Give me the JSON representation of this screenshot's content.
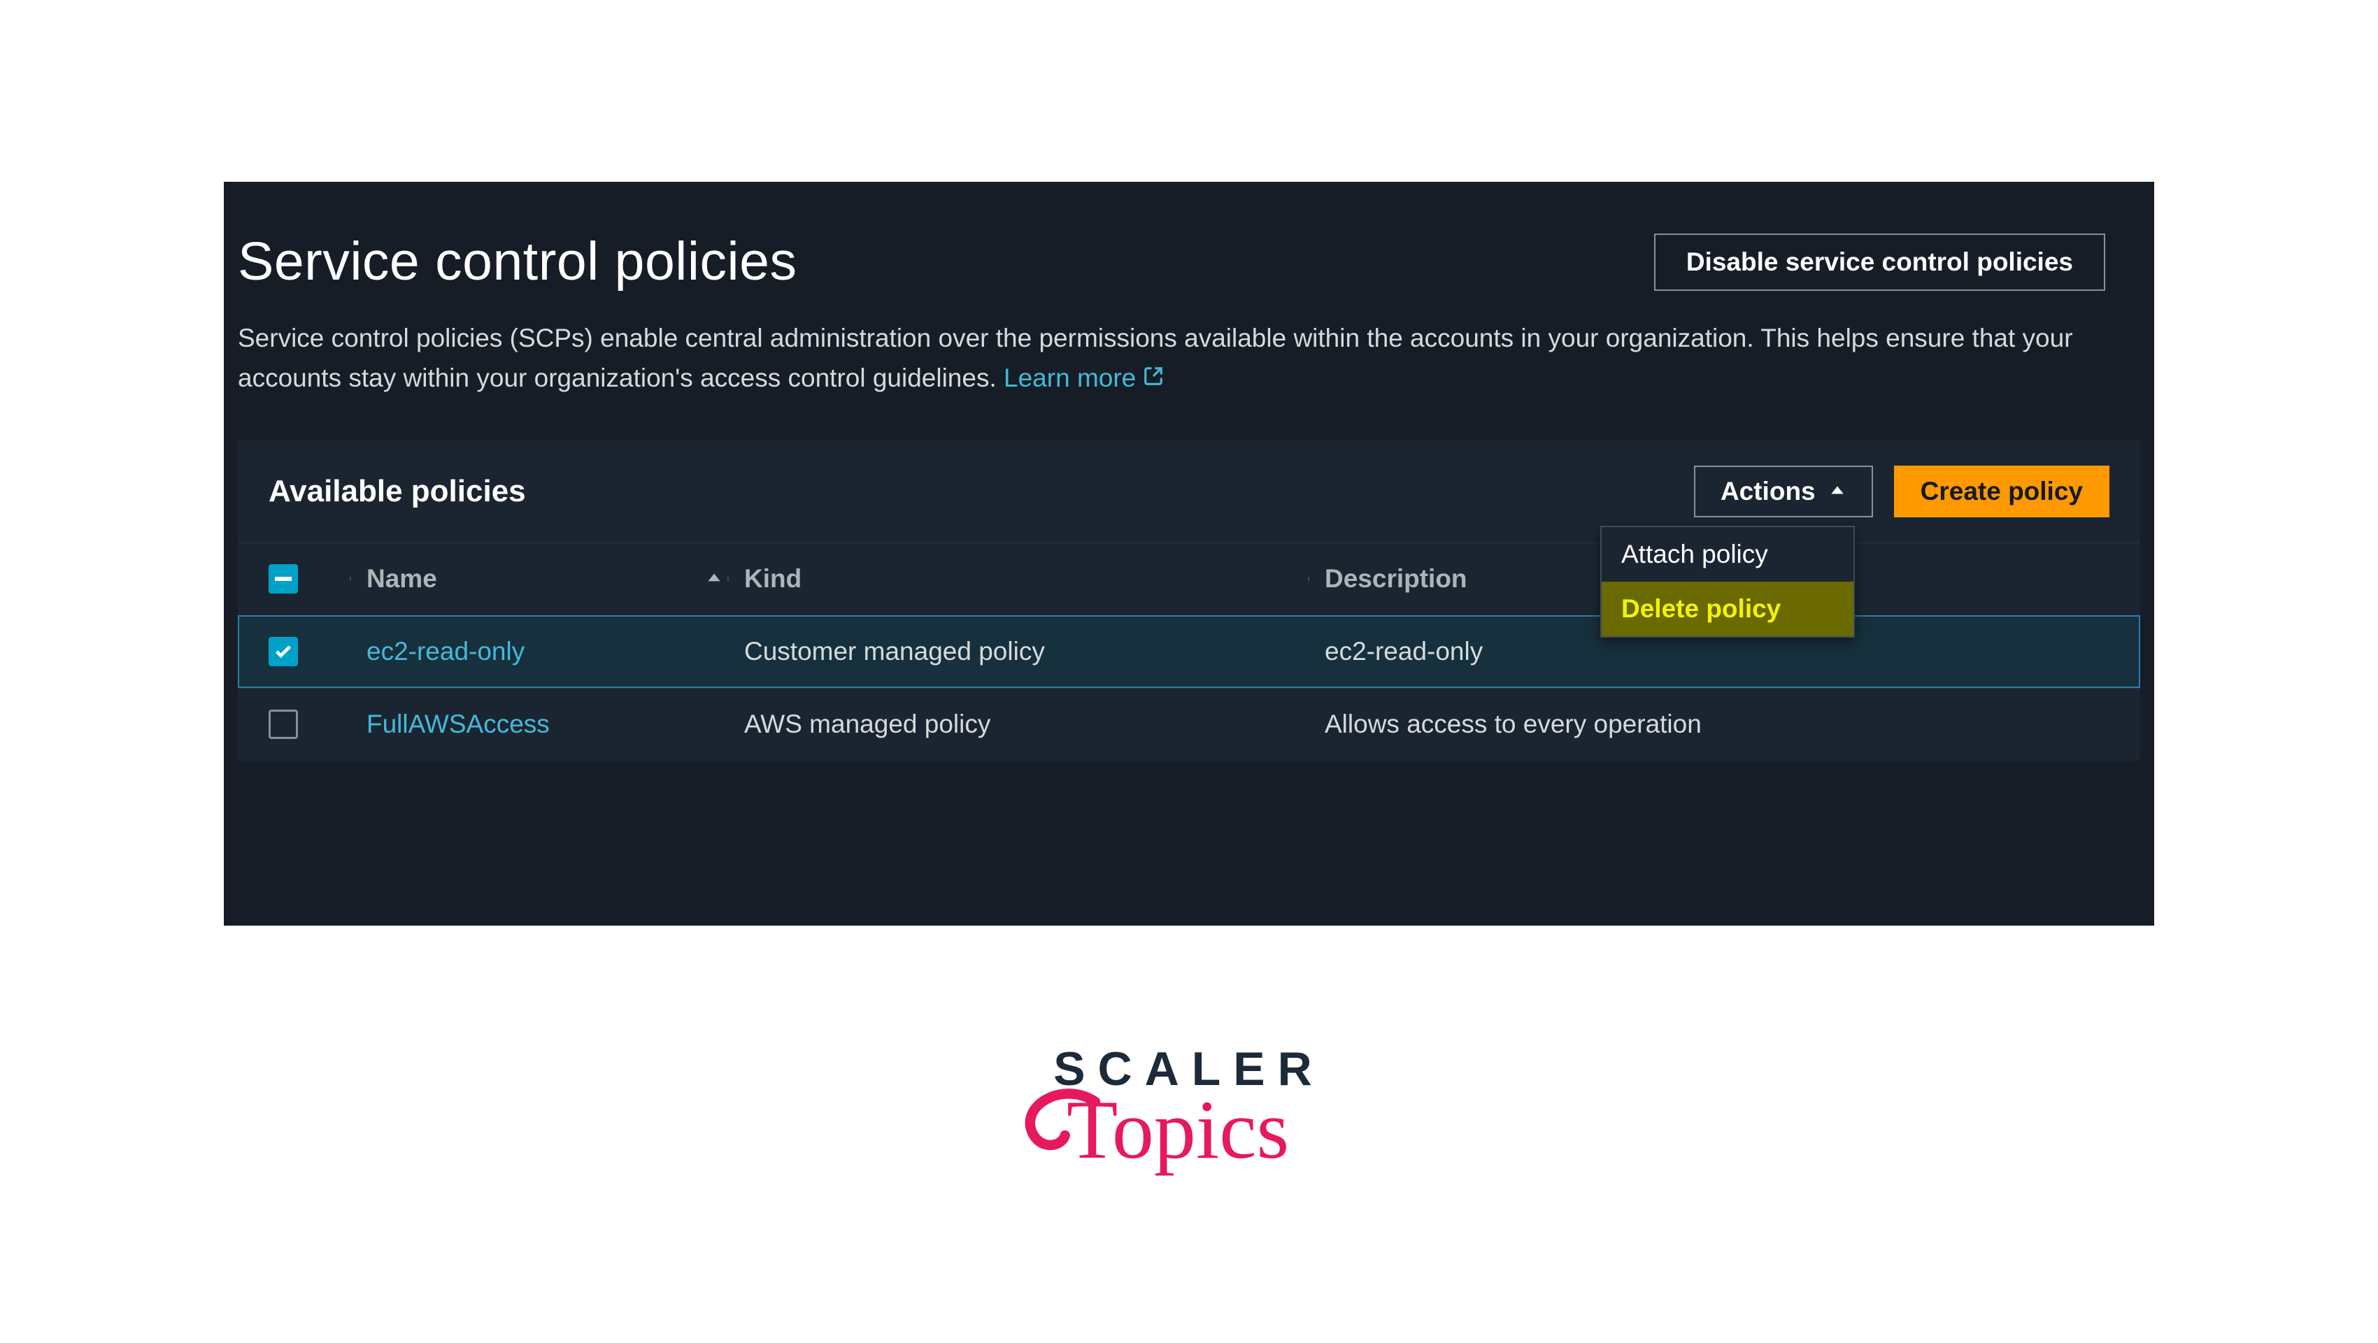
{
  "header": {
    "title": "Service control policies",
    "disable_label": "Disable service control policies"
  },
  "description": {
    "text": "Service control policies (SCPs) enable central administration over the permissions available within the accounts in your organization. This helps ensure that your accounts stay within your organization's access control guidelines.",
    "learn_more": "Learn more"
  },
  "panel": {
    "title": "Available policies",
    "actions_label": "Actions",
    "create_label": "Create policy"
  },
  "dropdown": {
    "attach": "Attach policy",
    "delete": "Delete policy"
  },
  "table": {
    "columns": {
      "name": "Name",
      "kind": "Kind",
      "description": "Description"
    },
    "rows": [
      {
        "selected": true,
        "name": "ec2-read-only",
        "kind": "Customer managed policy",
        "description": "ec2-read-only"
      },
      {
        "selected": false,
        "name": "FullAWSAccess",
        "kind": "AWS managed policy",
        "description": "Allows access to every operation"
      }
    ]
  },
  "branding": {
    "word1": "SCALER",
    "word2": "Topics"
  }
}
